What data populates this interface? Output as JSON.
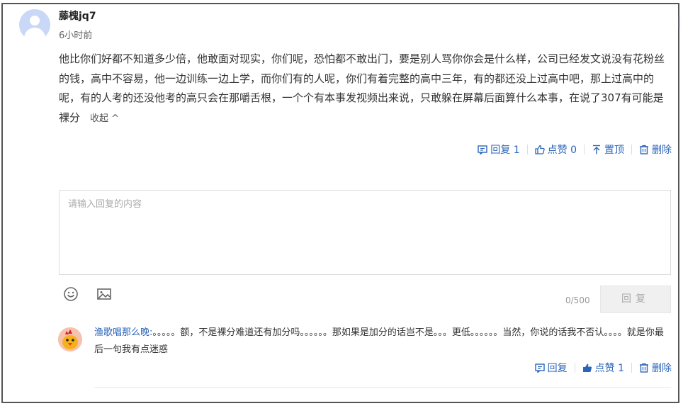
{
  "comment": {
    "username": "藤槐jq7",
    "time": "6小时前",
    "content": "他比你们好都不知道多少倍，他敢面对现实，你们呢，恐怕都不敢出门，要是别人骂你你会是什么样，公司已经发文说没有花粉丝的钱，高中不容易，他一边训练一边上学，而你们有的人呢，你们有着完整的高中三年，有的都还没上过高中吧，那上过高中的呢，有的人考的还没他考的高只会在那嚼舌根，一个个有本事发视频出来说，只敢躲在屏幕后面算什么本事，在说了307有可能是裸分",
    "collapse_label": "收起 ^",
    "actions": {
      "reply": "回复 1",
      "like": "点赞 0",
      "pin": "置顶",
      "delete": "删除"
    }
  },
  "reply_form": {
    "placeholder": "请输入回复的内容",
    "counter": "0/500",
    "submit_label": "回复"
  },
  "sub_reply": {
    "username": "渔歌唱那么晚:",
    "content": "。。。。。额，不是裸分难道还有加分吗。。。。。。那如果是加分的话岂不是。。。更低。。。。。。当然，你说的话我不否认。。。。就是你最后一句我有点迷惑",
    "actions": {
      "reply": "回复",
      "like": "点赞 1",
      "delete": "删除"
    }
  },
  "colors": {
    "accent": "#2b65b8",
    "avatar_bg": "#c9d8f6",
    "border": "#555555"
  }
}
